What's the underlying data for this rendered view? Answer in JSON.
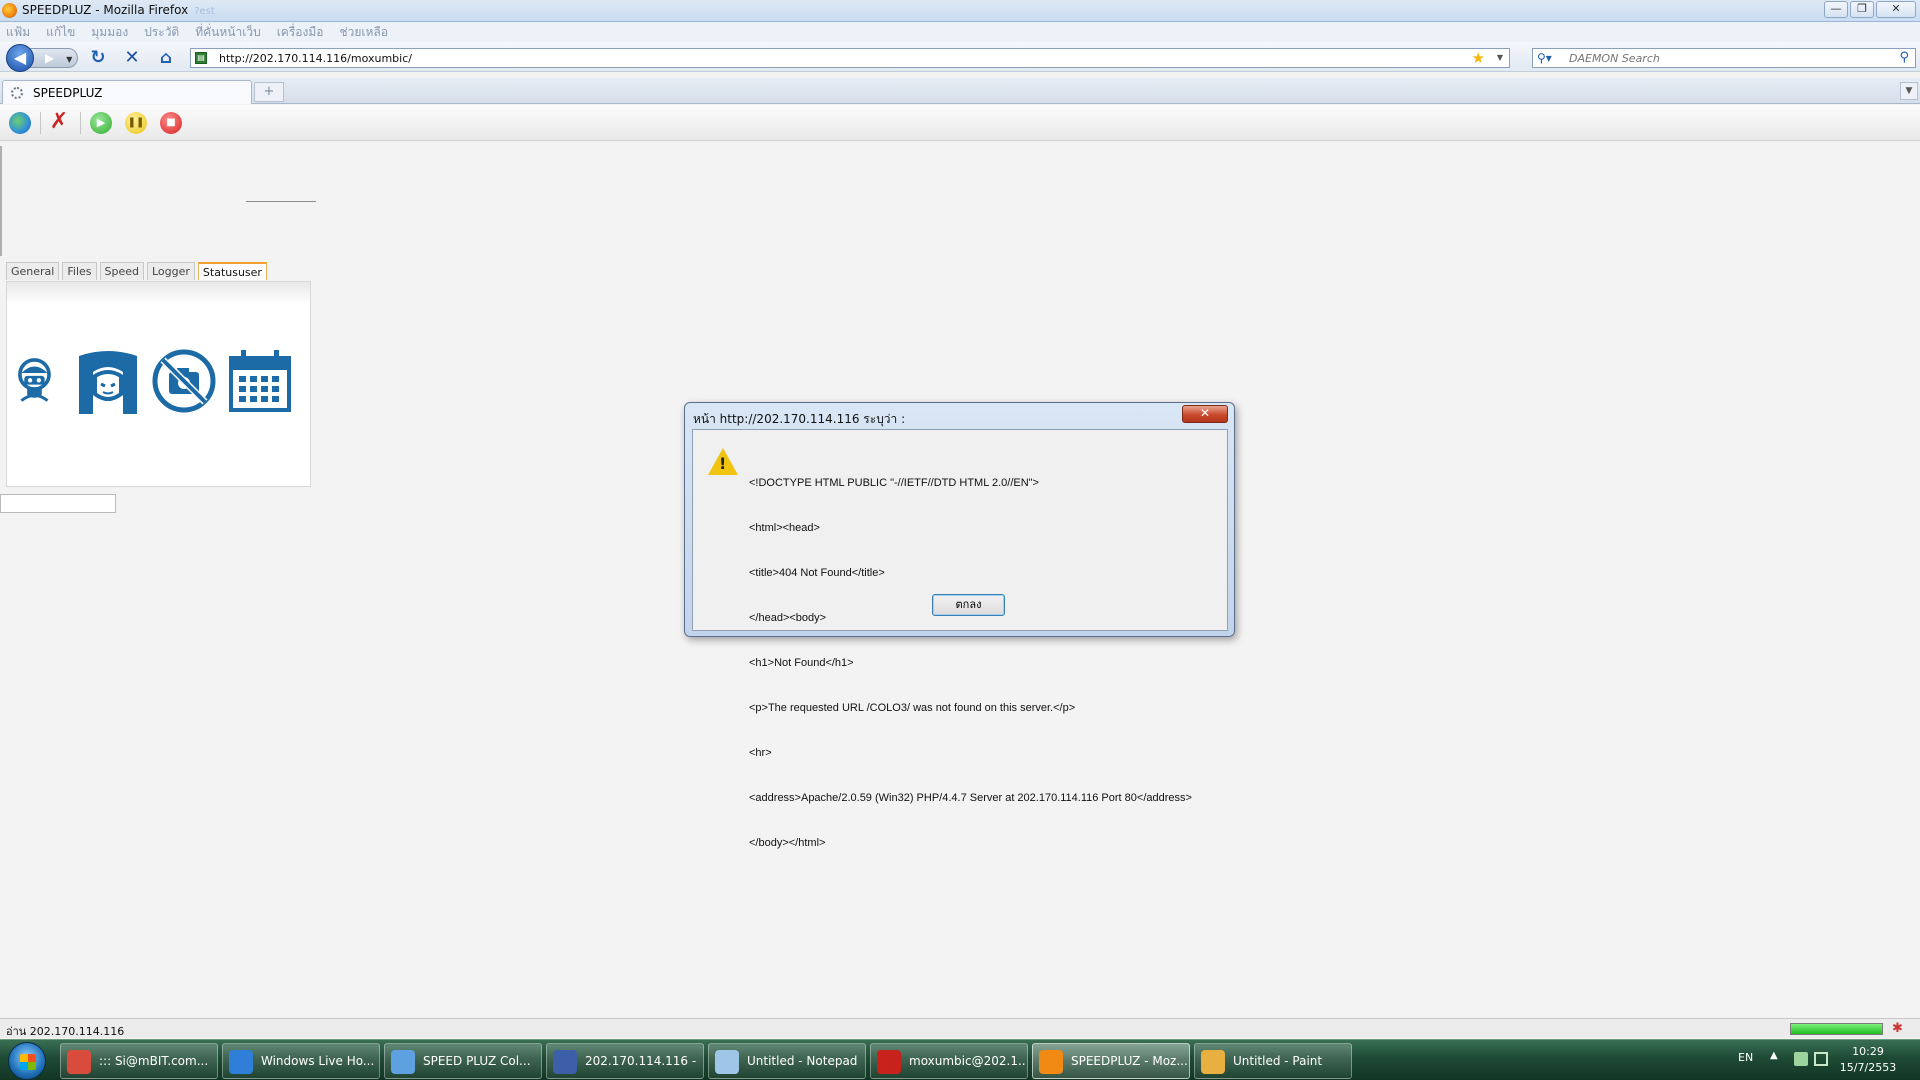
{
  "window": {
    "title": "SPEEDPLUZ - Mozilla Firefox",
    "title_ghost": "?est",
    "controls": {
      "minimize": "—",
      "maximize": "❐",
      "close": "✕"
    }
  },
  "menu": [
    "แฟ้ม",
    "แก้ไข",
    "มุมมอง",
    "ประวัติ",
    "ที่คั่นหน้าเว็บ",
    "เครื่องมือ",
    "ช่วยเหลือ"
  ],
  "nav": {
    "url": "http://202.170.114.116/moxumbic/",
    "search_placeholder": "DAEMON Search"
  },
  "browser_tab": {
    "label": "SPEEDPLUZ",
    "new_tab": "+"
  },
  "app_toolbar": {
    "icons": [
      "globe-icon",
      "delete-icon",
      "play-icon",
      "pause-icon",
      "stop-icon"
    ],
    "colors": {
      "globe": "#2f8fd8",
      "delete": "#cc2222",
      "play": "#2fae2f",
      "pause": "#e8c21a",
      "stop": "#d42020"
    }
  },
  "page_tabs": [
    "General",
    "Files",
    "Speed",
    "Logger",
    "Statususer"
  ],
  "active_page_tab": "Statususer",
  "status_icons": [
    "user-mask-icon",
    "girl-icon",
    "no-camera-icon",
    "calendar-icon"
  ],
  "icon_color": "#1c6aa6",
  "dialog": {
    "title": "หน้า http://202.170.114.116 ระบุว่า :",
    "close": "✕",
    "lines": [
      "<!DOCTYPE HTML PUBLIC \"-//IETF//DTD HTML 2.0//EN\">",
      "<html><head>",
      "<title>404 Not Found</title>",
      "</head><body>",
      "<h1>Not Found</h1>",
      "<p>The requested URL /COLO3/ was not found on this server.</p>",
      "<hr>",
      "<address>Apache/2.0.59 (Win32) PHP/4.4.7 Server at 202.170.114.116 Port 80</address>",
      "</body></html>"
    ],
    "ok_label": "ตกลง"
  },
  "statusbar": {
    "text": "อ่าน 202.170.114.116",
    "progress": 1.0
  },
  "taskbar": {
    "tasks": [
      {
        "label": "::: Si@mBIT.com...",
        "icon": "chrome-icon",
        "color": "#d94b3b"
      },
      {
        "label": "Windows Live Ho...",
        "icon": "ie-icon",
        "color": "#2f7fd8"
      },
      {
        "label": "SPEED PLUZ Col...",
        "icon": "messenger-icon",
        "color": "#5fa0e0"
      },
      {
        "label": "202.170.114.116 - ...",
        "icon": "remote-desktop-icon",
        "color": "#3c5fa8"
      },
      {
        "label": "Untitled - Notepad",
        "icon": "notepad-icon",
        "color": "#9fc6e6"
      },
      {
        "label": "moxumbic@202.1...",
        "icon": "filezilla-icon",
        "color": "#c7221b"
      },
      {
        "label": "SPEEDPLUZ - Moz...",
        "icon": "firefox-icon",
        "color": "#f08a14"
      },
      {
        "label": "Untitled - Paint",
        "icon": "paint-icon",
        "color": "#e8b040"
      }
    ],
    "active_index": 6,
    "tray": {
      "lang": "EN",
      "time": "10:29",
      "date": "15/7/2553"
    }
  }
}
